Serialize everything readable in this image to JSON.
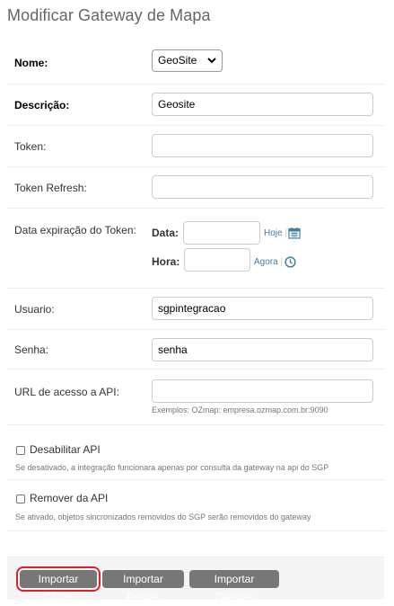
{
  "page": {
    "title": "Modificar Gateway de Mapa"
  },
  "form": {
    "nome": {
      "label": "Nome:",
      "value": "GeoSite"
    },
    "descricao": {
      "label": "Descrição:",
      "value": "Geosite"
    },
    "token": {
      "label": "Token:",
      "value": ""
    },
    "token_refresh": {
      "label": "Token Refresh:",
      "value": ""
    },
    "data_expiracao": {
      "label": "Data expiração do Token:",
      "data_label": "Data:",
      "data_value": "",
      "hoje_link": "Hoje",
      "sep": "|",
      "hora_label": "Hora:",
      "hora_value": "",
      "agora_link": "Agora"
    },
    "usuario": {
      "label": "Usuario:",
      "value": "sgpintegracao"
    },
    "senha": {
      "label": "Senha:",
      "value": "senha"
    },
    "url_api": {
      "label": "URL de acesso a API:",
      "value": "",
      "help": "Exemplos: OZmap: empresa.ozmap.com.br:9090"
    },
    "desabilitar_api": {
      "label": "Desabilitar API",
      "checked": false,
      "help": "Se desativado, a integração funcionara apenas por consulta da gateway na api do SGP"
    },
    "remover_api": {
      "label": "Remover da API",
      "checked": false,
      "help": "Se ativado, objetos sincronizados removidos do SGP serão removidos do gateway"
    }
  },
  "actions": {
    "importar_ctos": "Importar CTOS",
    "importar_postes": "Importar Postes",
    "importar_clientes": "Importar Clientes"
  },
  "colors": {
    "link": "#447e9b",
    "button": "#777777",
    "highlight": "#e0202a"
  },
  "icons": {
    "calendar": "calendar-icon",
    "clock": "clock-icon",
    "dropdown": "chevron-down-icon"
  }
}
